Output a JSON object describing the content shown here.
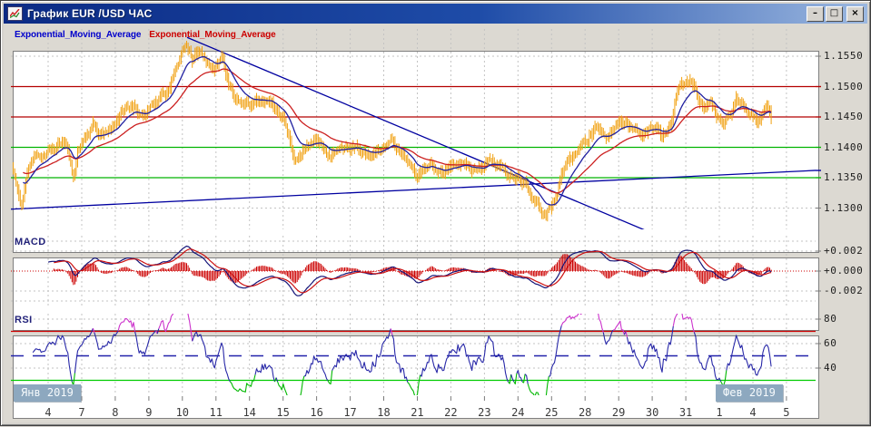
{
  "window": {
    "title": "График EUR /USD ЧАС",
    "minimize_label": "–",
    "maximize_label": "□",
    "close_label": "×"
  },
  "panels": {
    "main": {
      "legend": [
        {
          "label": "Exponential_Moving_Average",
          "color": "#0000cc"
        },
        {
          "label": "Exponential_Moving_Average",
          "color": "#cc0000"
        }
      ]
    },
    "macd": {
      "label": "MACD"
    },
    "rsi": {
      "label": "RSI"
    }
  },
  "axes": {
    "price_ticks": [
      "1.1550",
      "1.1500",
      "1.1450",
      "1.1400",
      "1.1350",
      "1.1300"
    ],
    "macd_ticks": [
      "+0.002",
      "+0.000",
      "-0.002"
    ],
    "rsi_ticks": [
      "80",
      "60",
      "40"
    ],
    "months": [
      "Янв 2019",
      "Фев 2019"
    ],
    "days": [
      "4",
      "7",
      "8",
      "9",
      "10",
      "11",
      "14",
      "15",
      "16",
      "17",
      "18",
      "21",
      "22",
      "23",
      "24",
      "25",
      "28",
      "29",
      "30",
      "31",
      "1",
      "4",
      "5"
    ]
  },
  "chart_data": [
    {
      "id": "price",
      "type": "ohlc-bars",
      "pair": "EUR/USD",
      "timeframe": "1 hour",
      "bar_color": "#f0a010",
      "y_ticks": [
        1.155,
        1.15,
        1.145,
        1.14,
        1.135,
        1.13
      ],
      "y_range_visible": [
        1.1265,
        1.1596
      ],
      "h_lines": [
        {
          "value": 1.15,
          "color": "#b40000"
        },
        {
          "value": 1.145,
          "color": "#b40000"
        },
        {
          "value": 1.14,
          "color": "#00b400"
        },
        {
          "value": 1.135,
          "color": "#00b400"
        }
      ],
      "grid_h_lines": [
        1.155,
        1.13
      ],
      "trend_lines": [
        {
          "from_day": 4.14,
          "from_price": 1.1581,
          "to_day": 17.81,
          "to_price": 1.1263,
          "color": "#0000a0"
        },
        {
          "from_day": -1.14,
          "from_price": 1.1298,
          "to_day": 22.87,
          "to_price": 1.1362,
          "color": "#0000a0"
        }
      ],
      "ema_fast": {
        "period": 16,
        "color": "#2020a0"
      },
      "ema_slow": {
        "period": 44,
        "color": "#cc2020"
      },
      "keypoints_day_price": [
        [
          -1.08,
          1.1372
        ],
        [
          -0.92,
          1.133
        ],
        [
          -0.8,
          1.1302
        ],
        [
          -0.62,
          1.1358
        ],
        [
          -0.38,
          1.1392
        ],
        [
          -0.12,
          1.1384
        ],
        [
          0.15,
          1.1398
        ],
        [
          0.45,
          1.1412
        ],
        [
          0.62,
          1.139
        ],
        [
          0.74,
          1.1342
        ],
        [
          0.86,
          1.1392
        ],
        [
          1.1,
          1.1418
        ],
        [
          1.35,
          1.1438
        ],
        [
          1.55,
          1.142
        ],
        [
          1.8,
          1.1428
        ],
        [
          2.05,
          1.1445
        ],
        [
          2.3,
          1.1462
        ],
        [
          2.55,
          1.147
        ],
        [
          2.8,
          1.1452
        ],
        [
          3.05,
          1.1462
        ],
        [
          3.35,
          1.1482
        ],
        [
          3.6,
          1.1492
        ],
        [
          3.8,
          1.1528
        ],
        [
          4.0,
          1.1558
        ],
        [
          4.14,
          1.1571
        ],
        [
          4.3,
          1.1545
        ],
        [
          4.5,
          1.1558
        ],
        [
          4.72,
          1.154
        ],
        [
          5.0,
          1.153
        ],
        [
          5.18,
          1.1544
        ],
        [
          5.4,
          1.1502
        ],
        [
          5.62,
          1.148
        ],
        [
          5.85,
          1.147
        ],
        [
          6.1,
          1.1472
        ],
        [
          6.3,
          1.1482
        ],
        [
          6.55,
          1.1475
        ],
        [
          6.82,
          1.1462
        ],
        [
          7.0,
          1.145
        ],
        [
          7.15,
          1.142
        ],
        [
          7.32,
          1.138
        ],
        [
          7.55,
          1.139
        ],
        [
          7.78,
          1.1402
        ],
        [
          7.95,
          1.1412
        ],
        [
          8.15,
          1.14
        ],
        [
          8.4,
          1.1388
        ],
        [
          8.65,
          1.1396
        ],
        [
          8.9,
          1.1404
        ],
        [
          9.2,
          1.1398
        ],
        [
          9.5,
          1.1388
        ],
        [
          9.8,
          1.1396
        ],
        [
          10.05,
          1.1402
        ],
        [
          10.25,
          1.141
        ],
        [
          10.55,
          1.1388
        ],
        [
          10.8,
          1.1368
        ],
        [
          10.95,
          1.1348
        ],
        [
          11.15,
          1.1364
        ],
        [
          11.45,
          1.137
        ],
        [
          11.75,
          1.1358
        ],
        [
          12.05,
          1.1366
        ],
        [
          12.35,
          1.1376
        ],
        [
          12.65,
          1.1364
        ],
        [
          12.95,
          1.137
        ],
        [
          13.2,
          1.138
        ],
        [
          13.5,
          1.1366
        ],
        [
          13.8,
          1.1354
        ],
        [
          14.05,
          1.1348
        ],
        [
          14.25,
          1.1342
        ],
        [
          14.45,
          1.1318
        ],
        [
          14.65,
          1.13
        ],
        [
          14.82,
          1.1292
        ],
        [
          15.0,
          1.1302
        ],
        [
          15.15,
          1.1316
        ],
        [
          15.32,
          1.136
        ],
        [
          15.55,
          1.1382
        ],
        [
          15.8,
          1.1396
        ],
        [
          16.05,
          1.1414
        ],
        [
          16.35,
          1.1432
        ],
        [
          16.62,
          1.1422
        ],
        [
          16.9,
          1.1436
        ],
        [
          17.2,
          1.1442
        ],
        [
          17.5,
          1.1432
        ],
        [
          17.8,
          1.1426
        ],
        [
          18.05,
          1.1432
        ],
        [
          18.3,
          1.142
        ],
        [
          18.55,
          1.1436
        ],
        [
          18.7,
          1.149
        ],
        [
          18.85,
          1.1506
        ],
        [
          19.0,
          1.1498
        ],
        [
          19.15,
          1.1514
        ],
        [
          19.32,
          1.1488
        ],
        [
          19.52,
          1.1462
        ],
        [
          19.72,
          1.1476
        ],
        [
          19.9,
          1.1452
        ],
        [
          20.1,
          1.1442
        ],
        [
          20.32,
          1.1452
        ],
        [
          20.52,
          1.1484
        ],
        [
          20.72,
          1.147
        ],
        [
          20.92,
          1.1456
        ],
        [
          21.1,
          1.1446
        ],
        [
          21.3,
          1.146
        ],
        [
          21.45,
          1.1464
        ],
        [
          21.58,
          1.1442
        ]
      ]
    },
    {
      "id": "macd",
      "type": "line+histogram",
      "params": {
        "fast": 12,
        "slow": 26,
        "signal": 9
      },
      "y_ticks": [
        0.002,
        0.0,
        -0.002
      ],
      "line_color": "#141478",
      "signal_color": "#cc1111",
      "histogram_color": "#cc0000",
      "zero_line_color": "#cc0000"
    },
    {
      "id": "rsi",
      "type": "line",
      "period": 14,
      "y_ticks": [
        80,
        60,
        40
      ],
      "levels": [
        {
          "value": 70,
          "color": "#cc0000",
          "style": "solid"
        },
        {
          "value": 50,
          "color": "#2222aa",
          "style": "dashed"
        },
        {
          "value": 30,
          "color": "#00cc00",
          "style": "solid"
        }
      ],
      "line_color": "#2828a8",
      "overbought_color": "#cc33cc",
      "oversold_color": "#00b800"
    }
  ]
}
